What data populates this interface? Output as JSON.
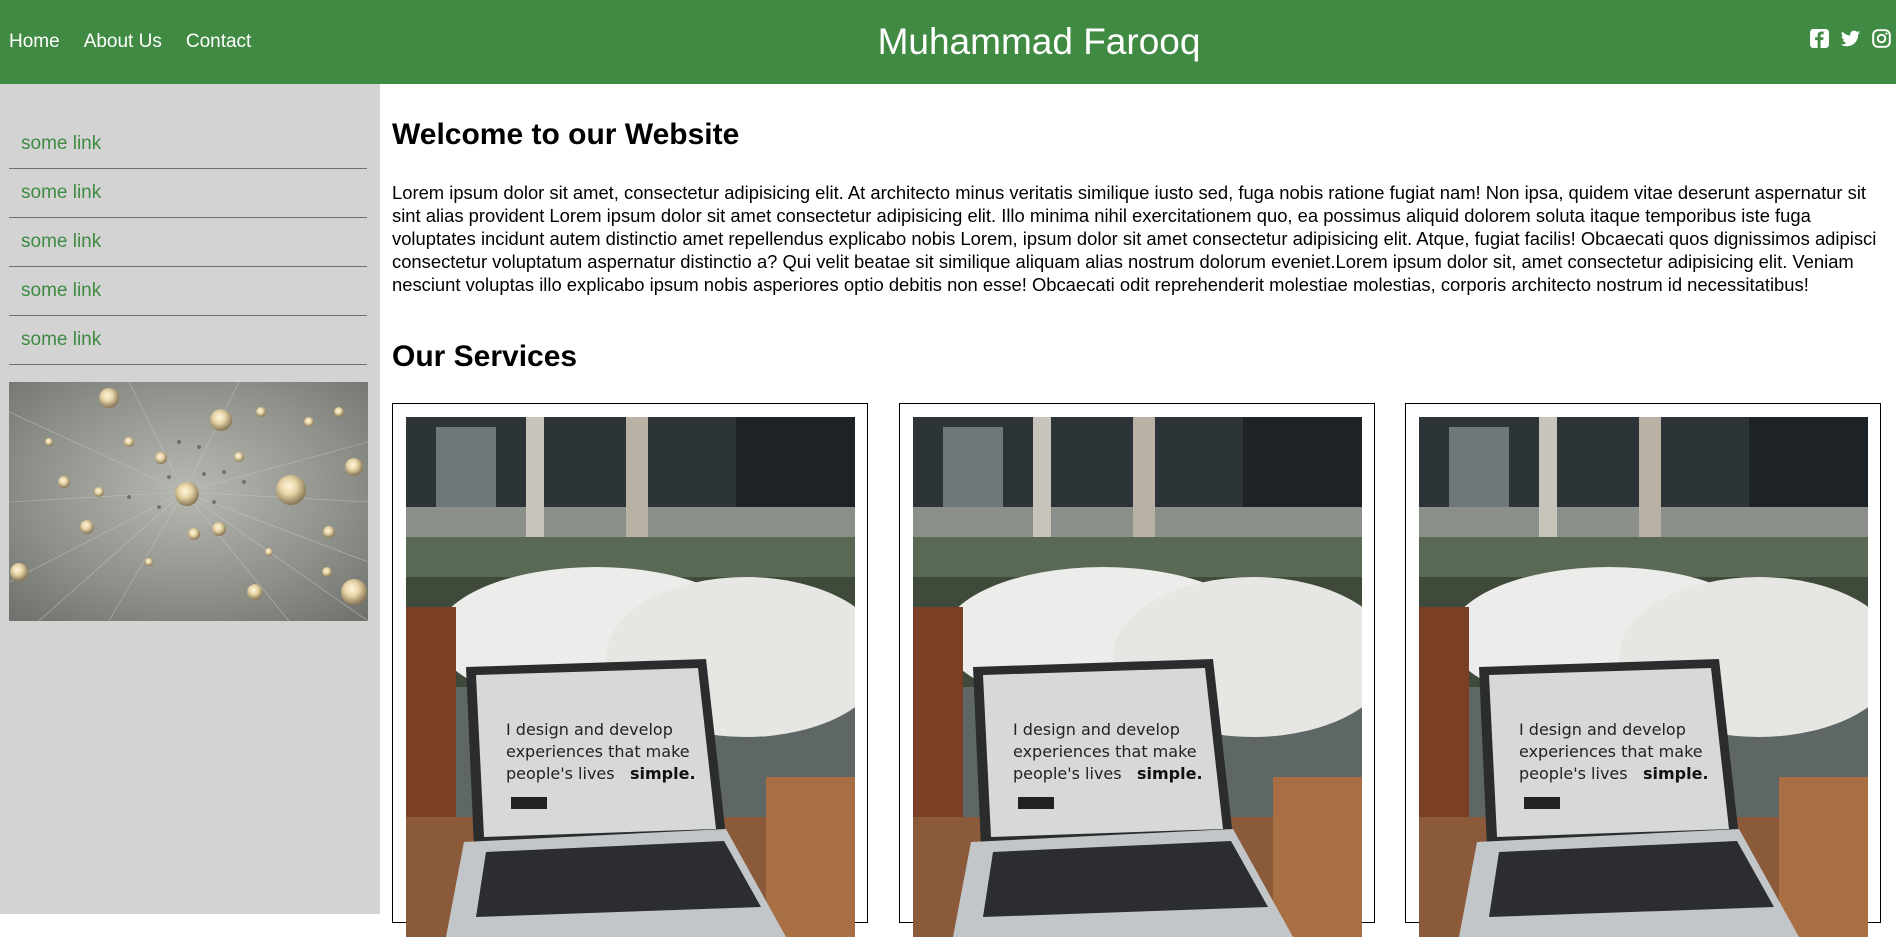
{
  "header": {
    "nav": [
      "Home",
      "About Us",
      "Contact"
    ],
    "brand": "Muhammad Farooq",
    "social_icons": [
      "facebook-square-icon",
      "twitter-icon",
      "instagram-icon"
    ],
    "color": "#418a43"
  },
  "sidebar": {
    "links": [
      "some link",
      "some link",
      "some link",
      "some link",
      "some link"
    ],
    "background": "#d3d3d3",
    "link_color": "#3f8a42"
  },
  "main": {
    "welcome_title": "Welcome to our Website",
    "welcome_text": "Lorem ipsum dolor sit amet, consectetur adipisicing elit. At architecto minus veritatis similique iusto sed, fuga nobis ratione fugiat nam! Non ipsa, quidem vitae deserunt aspernatur sit sint alias provident Lorem ipsum dolor sit amet consectetur adipisicing elit. Illo minima nihil exercitationem quo, ea possimus aliquid dolorem soluta itaque temporibus iste fuga voluptates incidunt autem distinctio amet repellendus explicabo nobis Lorem, ipsum dolor sit amet consectetur adipisicing elit. Atque, fugiat facilis! Obcaecati quos dignissimos adipisci consectetur voluptatum aspernatur distinctio a? Qui velit beatae sit similique aliquam alias nostrum dolorum eveniet.Lorem ipsum dolor sit, amet consectetur adipisicing elit. Veniam nesciunt voluptas illo explicabo ipsum nobis asperiores optio debitis non esse! Obcaecati odit reprehenderit molestiae molestias, corporis architecto nostrum id necessitatibus!",
    "services_title": "Our Services",
    "service_cards": [
      {
        "screen_text_line1": "I design and develop",
        "screen_text_line2": "experiences that make",
        "screen_text_line3": "people's lives",
        "screen_text_bold": "simple."
      },
      {
        "screen_text_line1": "I design and develop",
        "screen_text_line2": "experiences that make",
        "screen_text_line3": "people's lives",
        "screen_text_bold": "simple."
      },
      {
        "screen_text_line1": "I design and develop",
        "screen_text_line2": "experiences that make",
        "screen_text_line3": "people's lives",
        "screen_text_bold": "simple."
      }
    ]
  }
}
